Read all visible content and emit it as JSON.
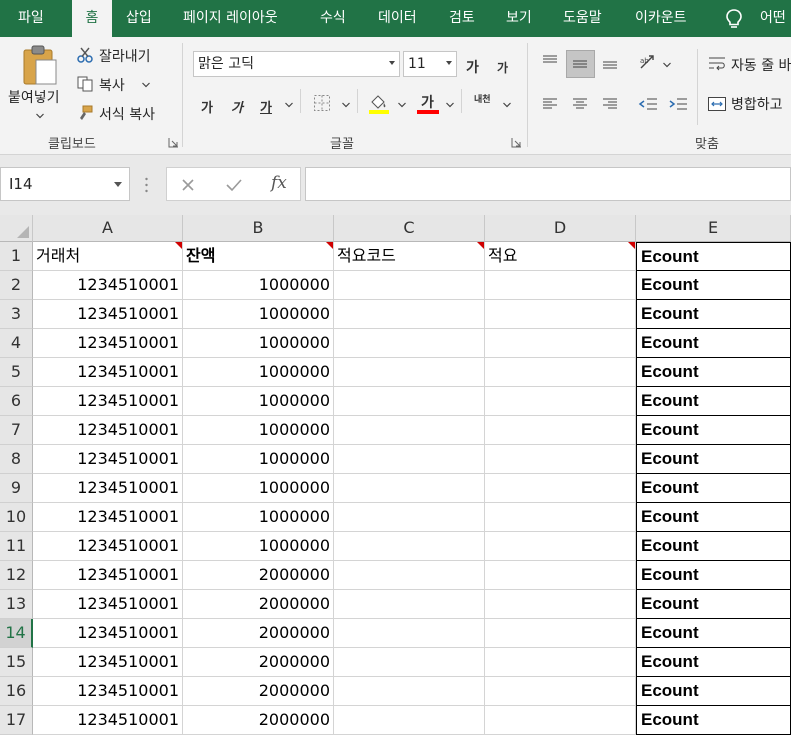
{
  "ribbon_tabs": [
    "파일",
    "홈",
    "삽입",
    "페이지 레이아웃",
    "수식",
    "데이터",
    "검토",
    "보기",
    "도움말",
    "이카운트",
    "어떤"
  ],
  "active_tab_index": 1,
  "colors": {
    "excel_green": "#217346",
    "fill_color_bar": "#ffff00",
    "font_color_bar": "#ff0000",
    "comment_marker": "#d00000"
  },
  "clipboard": {
    "paste_label": "붙여넣기",
    "cut_label": "잘라내기",
    "copy_label": "복사",
    "format_painter_label": "서식 복사",
    "group_label": "클립보드"
  },
  "font": {
    "font_name": "맑은 고딕",
    "font_size": "11",
    "increase_size_glyph": "가",
    "decrease_size_glyph": "가",
    "bold_glyph": "가",
    "italic_glyph": "가",
    "underline_glyph": "가",
    "font_color_glyph": "가",
    "phonetic_glyph": "내천",
    "group_label": "글꼴"
  },
  "alignment": {
    "wrap_text_label": "자동 줄 바",
    "merge_center_label": "병합하고",
    "group_label": "맞춤"
  },
  "formula_bar": {
    "name_box": "I14",
    "fx_label": "fx",
    "formula": ""
  },
  "sheet": {
    "columns": [
      "A",
      "B",
      "C",
      "D",
      "E"
    ],
    "selected_row": "14",
    "rows": [
      {
        "num": "1",
        "a": "거래처",
        "b": "잔액",
        "c": "적요코드",
        "d": "적요",
        "e": "Ecount"
      },
      {
        "num": "2",
        "a": "1234510001",
        "b": "1000000",
        "c": "",
        "d": "",
        "e": "Ecount"
      },
      {
        "num": "3",
        "a": "1234510001",
        "b": "1000000",
        "c": "",
        "d": "",
        "e": "Ecount"
      },
      {
        "num": "4",
        "a": "1234510001",
        "b": "1000000",
        "c": "",
        "d": "",
        "e": "Ecount"
      },
      {
        "num": "5",
        "a": "1234510001",
        "b": "1000000",
        "c": "",
        "d": "",
        "e": "Ecount"
      },
      {
        "num": "6",
        "a": "1234510001",
        "b": "1000000",
        "c": "",
        "d": "",
        "e": "Ecount"
      },
      {
        "num": "7",
        "a": "1234510001",
        "b": "1000000",
        "c": "",
        "d": "",
        "e": "Ecount"
      },
      {
        "num": "8",
        "a": "1234510001",
        "b": "1000000",
        "c": "",
        "d": "",
        "e": "Ecount"
      },
      {
        "num": "9",
        "a": "1234510001",
        "b": "1000000",
        "c": "",
        "d": "",
        "e": "Ecount"
      },
      {
        "num": "10",
        "a": "1234510001",
        "b": "1000000",
        "c": "",
        "d": "",
        "e": "Ecount"
      },
      {
        "num": "11",
        "a": "1234510001",
        "b": "1000000",
        "c": "",
        "d": "",
        "e": "Ecount"
      },
      {
        "num": "12",
        "a": "1234510001",
        "b": "2000000",
        "c": "",
        "d": "",
        "e": "Ecount"
      },
      {
        "num": "13",
        "a": "1234510001",
        "b": "2000000",
        "c": "",
        "d": "",
        "e": "Ecount"
      },
      {
        "num": "14",
        "a": "1234510001",
        "b": "2000000",
        "c": "",
        "d": "",
        "e": "Ecount"
      },
      {
        "num": "15",
        "a": "1234510001",
        "b": "2000000",
        "c": "",
        "d": "",
        "e": "Ecount"
      },
      {
        "num": "16",
        "a": "1234510001",
        "b": "2000000",
        "c": "",
        "d": "",
        "e": "Ecount"
      },
      {
        "num": "17",
        "a": "1234510001",
        "b": "2000000",
        "c": "",
        "d": "",
        "e": "Ecount"
      }
    ]
  }
}
